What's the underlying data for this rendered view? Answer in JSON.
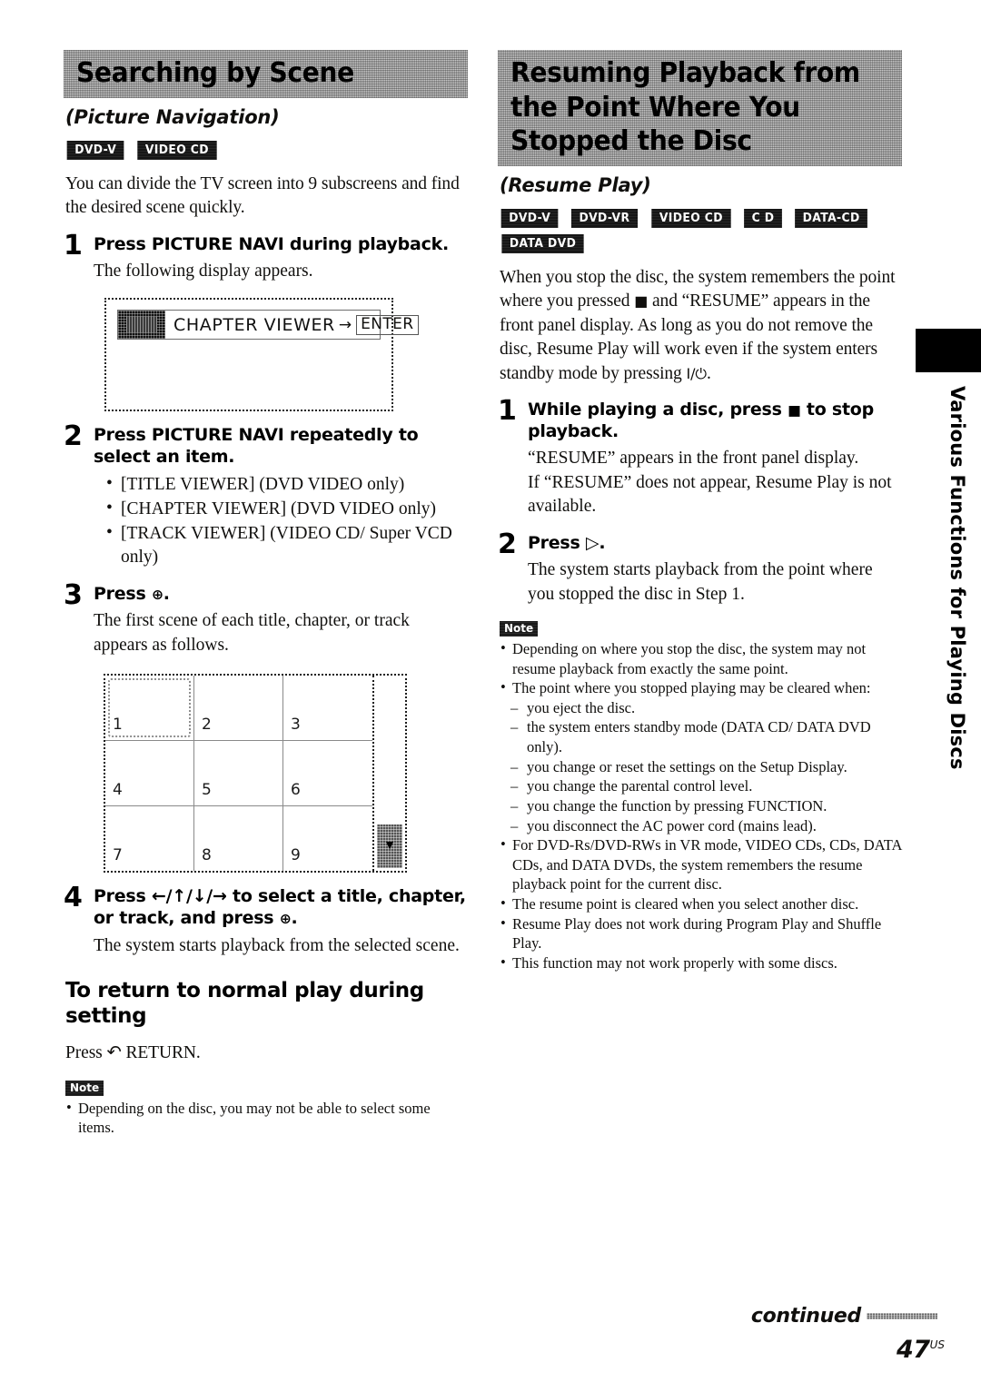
{
  "left_column": {
    "banner_title": "Searching by Scene",
    "subtitle": "(Picture Navigation)",
    "badges": [
      "DVD-V",
      "VIDEO CD"
    ],
    "intro": "You can divide the TV screen into 9 subscreens and find the desired scene quickly.",
    "steps": [
      {
        "num": "1",
        "title": "Press PICTURE NAVI during playback.",
        "desc": "The following display appears."
      },
      {
        "num": "2",
        "title": "Press PICTURE NAVI repeatedly to select an item.",
        "bullets": [
          "[TITLE VIEWER] (DVD VIDEO only)",
          "[CHAPTER VIEWER] (DVD VIDEO only)",
          "[TRACK VIEWER] (VIDEO CD/ Super VCD only)"
        ]
      },
      {
        "num": "3",
        "title_pre": "Press",
        "title_post": ".",
        "desc": "The first scene of each title, chapter, or track appears as follows."
      },
      {
        "num": "4",
        "title_pre": "Press ←/↑/↓/→ to select a title, chapter, or track, and press",
        "title_post": ".",
        "desc": "The system starts playback from the selected scene."
      }
    ],
    "osd": {
      "label": "CHAPTER VIEWER",
      "arrow": "→",
      "enter": "ENTER"
    },
    "grid": {
      "cells": [
        "1",
        "2",
        "3",
        "4",
        "5",
        "6",
        "7",
        "8",
        "9"
      ],
      "selected_cell": "1",
      "scroll_arrow": "▼"
    },
    "subhead": "To return to normal play during setting",
    "subhead_body": "Press ↶ RETURN.",
    "note_tag": "Note",
    "notes": [
      "Depending on the disc, you may not be able to select some items."
    ]
  },
  "right_column": {
    "banner_title": "Resuming Playback from the Point Where You Stopped the Disc",
    "subtitle": "(Resume Play)",
    "badges": [
      "DVD-V",
      "DVD-VR",
      "VIDEO CD",
      "C D",
      "DATA-CD",
      "DATA DVD"
    ],
    "intro_part1": "When you stop the disc, the system remembers the point where you pressed",
    "intro_part2": "and “RESUME” appears in the front panel display. As long as you do not remove the disc, Resume Play will work even if the system enters standby mode by pressing",
    "intro_part3": ".",
    "steps": [
      {
        "num": "1",
        "title_pre": "While playing a disc, press",
        "title_post": "to stop playback.",
        "desc1": "“RESUME” appears in the front panel display.",
        "desc2": "If “RESUME” does not appear, Resume Play is not available."
      },
      {
        "num": "2",
        "title_pre": "Press",
        "title_post": ".",
        "desc1": "The system starts playback from the point where you stopped the disc in Step 1."
      }
    ],
    "note_tag": "Note",
    "notes": [
      "Depending on where you stop the disc, the system may not resume playback from exactly the same point.",
      "The point where you stopped playing may be cleared when:"
    ],
    "note_dashes": [
      "you eject the disc.",
      "the system enters standby mode (DATA CD/ DATA DVD only).",
      "you change or reset the settings on the Setup Display.",
      "you change the parental control level.",
      "you change the function by pressing FUNCTION.",
      "you disconnect the AC power cord (mains lead)."
    ],
    "notes_tail": [
      "For DVD-Rs/DVD-RWs in VR mode, VIDEO CDs, CDs, DATA CDs, and DATA DVDs, the system remembers the resume playback point for the current disc.",
      "The resume point is cleared when you select another disc.",
      "Resume Play does not work during Program Play and Shuffle Play.",
      "This function may not work properly with some discs."
    ]
  },
  "side_tab": {
    "label": "Various Functions for Playing Discs"
  },
  "footer": {
    "continued": "continued",
    "page_number": "47",
    "page_suffix": "US"
  },
  "glyphs": {
    "enter_circle": "⊕",
    "stop_square": "■",
    "play_triangle": "▷",
    "power": "I/⏻"
  }
}
